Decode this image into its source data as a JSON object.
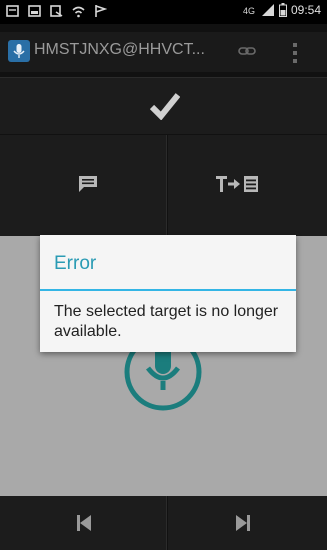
{
  "status_bar": {
    "time": "09:54",
    "network": "4G"
  },
  "action_bar": {
    "title": "HMSTJNXG@HHVCT..."
  },
  "dialog": {
    "title": "Error",
    "message": "The selected target is no longer available."
  },
  "colors": {
    "accent": "#33b5e5",
    "title_text": "#2a9bb4",
    "mic_teal": "#1b7d7d",
    "app_logo": "#2a6fa6"
  },
  "icons": {
    "check": "check-icon",
    "chat": "chat-icon",
    "text_to_doc": "text-to-document-icon",
    "microphone": "microphone-icon",
    "previous": "skip-previous-icon",
    "next": "skip-next-icon",
    "link": "link-icon",
    "overflow": "overflow-menu-icon"
  }
}
